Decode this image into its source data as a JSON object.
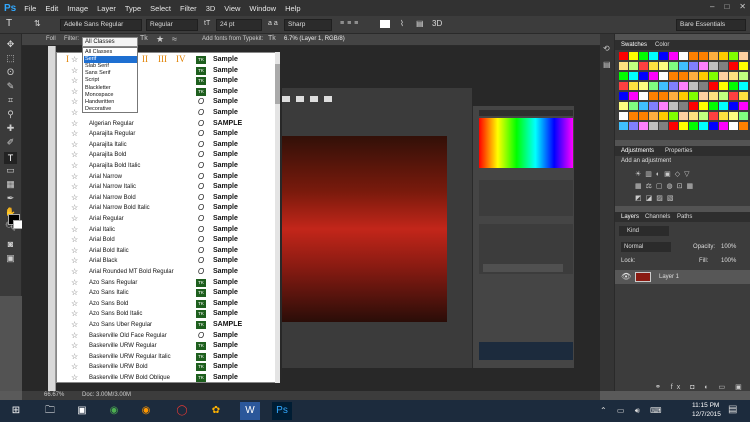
{
  "menu": {
    "logo": "Ps",
    "items": [
      "File",
      "Edit",
      "Image",
      "Layer",
      "Type",
      "Select",
      "Filter",
      "3D",
      "View",
      "Window",
      "Help"
    ]
  },
  "options": {
    "font_family": "Adelle Sans Regular",
    "font_style": "Regular",
    "font_size": "24 pt",
    "aa": "Sharp",
    "workspace": "Bare Essentials"
  },
  "filterbar": {
    "fold_label": "Foll",
    "filter_label": "Filter:",
    "class_value": "All Classes",
    "add_fonts": "Add fonts from Typekit:",
    "doc_tab": "6.7% (Layer 1, RGB/8)"
  },
  "class_options": [
    "All Classes",
    "Serif",
    "Slab Serif",
    "Sans Serif",
    "Script",
    "Blackletter",
    "Monospace",
    "Handwritten",
    "Decorative"
  ],
  "roman_numerals": [
    "I",
    "II",
    "III",
    "IV"
  ],
  "fonts": [
    {
      "name": "",
      "tt": "TK",
      "sample": "Sample"
    },
    {
      "name": "",
      "tt": "TK",
      "sample": "Sample"
    },
    {
      "name": "",
      "tt": "TK",
      "sample": "Sample"
    },
    {
      "name": "",
      "tt": "TK",
      "sample": "Sample"
    },
    {
      "name": "",
      "tt": "O",
      "sample": "Sample"
    },
    {
      "name": "",
      "tt": "O",
      "sample": "Sample"
    },
    {
      "name": "Algerian Regular",
      "tt": "O",
      "sample": "SAMPLE"
    },
    {
      "name": "Aparajita Regular",
      "tt": "O",
      "sample": "Sample"
    },
    {
      "name": "Aparajita Italic",
      "tt": "O",
      "sample": "Sample"
    },
    {
      "name": "Aparajita Bold",
      "tt": "O",
      "sample": "Sample"
    },
    {
      "name": "Aparajita Bold Italic",
      "tt": "O",
      "sample": "Sample"
    },
    {
      "name": "Arial Narrow",
      "tt": "O",
      "sample": "Sample"
    },
    {
      "name": "Arial Narrow Italic",
      "tt": "O",
      "sample": "Sample"
    },
    {
      "name": "Arial Narrow Bold",
      "tt": "O",
      "sample": "Sample"
    },
    {
      "name": "Arial Narrow Bold Italic",
      "tt": "O",
      "sample": "Sample"
    },
    {
      "name": "Arial Regular",
      "tt": "O",
      "sample": "Sample"
    },
    {
      "name": "Arial Italic",
      "tt": "O",
      "sample": "Sample"
    },
    {
      "name": "Arial Bold",
      "tt": "O",
      "sample": "Sample"
    },
    {
      "name": "Arial Bold Italic",
      "tt": "O",
      "sample": "Sample"
    },
    {
      "name": "Arial Black",
      "tt": "O",
      "sample": "Sample"
    },
    {
      "name": "Arial Rounded MT Bold Regular",
      "tt": "O",
      "sample": "Sample"
    },
    {
      "name": "Azo Sans Regular",
      "tt": "TK",
      "sample": "Sample"
    },
    {
      "name": "Azo Sans Italic",
      "tt": "TK",
      "sample": "Sample"
    },
    {
      "name": "Azo Sans Bold",
      "tt": "TK",
      "sample": "Sample"
    },
    {
      "name": "Azo Sans Bold Italic",
      "tt": "TK",
      "sample": "Sample"
    },
    {
      "name": "Azo Sans Uber Regular",
      "tt": "TK",
      "sample": "SAMPLE"
    },
    {
      "name": "Baskerville Old Face Regular",
      "tt": "O",
      "sample": "Sample"
    },
    {
      "name": "Baskerville URW Regular",
      "tt": "TK",
      "sample": "Sample"
    },
    {
      "name": "Baskerville URW Regular Italic",
      "tt": "TK",
      "sample": "Sample"
    },
    {
      "name": "Baskerville URW Bold",
      "tt": "TK",
      "sample": "Sample"
    },
    {
      "name": "Baskerville URW Bold Oblique",
      "tt": "TK",
      "sample": "Sample"
    }
  ],
  "panels": {
    "swatches_tab": "Swatches",
    "color_tab": "Color",
    "adjustments_tab": "Adjustments",
    "properties_tab": "Properties",
    "add_adjustment": "Add an adjustment",
    "layers_tab": "Layers",
    "channels_tab": "Channels",
    "paths_tab": "Paths",
    "kind": "Kind",
    "blend": "Normal",
    "opacity_label": "Opacity:",
    "opacity_value": "100%",
    "lock_label": "Lock:",
    "fill_label": "Fill:",
    "fill_value": "100%",
    "layer_name": "Layer 1"
  },
  "status": {
    "zoom": "66.67%",
    "doc": "Doc: 3.00M/3.00M"
  },
  "taskbar": {
    "time": "11:15 PM",
    "date": "12/7/2015"
  },
  "swatch_colors": [
    "#ff0000",
    "#ffff00",
    "#00ff00",
    "#00ffff",
    "#0000ff",
    "#ff00ff",
    "#ffffff",
    "#ff8000",
    "#ff8000",
    "#ffb040",
    "#ffcc00",
    "#80ff00",
    "#ffd0a0",
    "#ffe080",
    "#c0ff80",
    "#ff4040",
    "#ffe040",
    "#ffff80",
    "#80ff80",
    "#40c0ff",
    "#8080ff",
    "#ff80ff",
    "#c0c0c0",
    "#808080"
  ]
}
